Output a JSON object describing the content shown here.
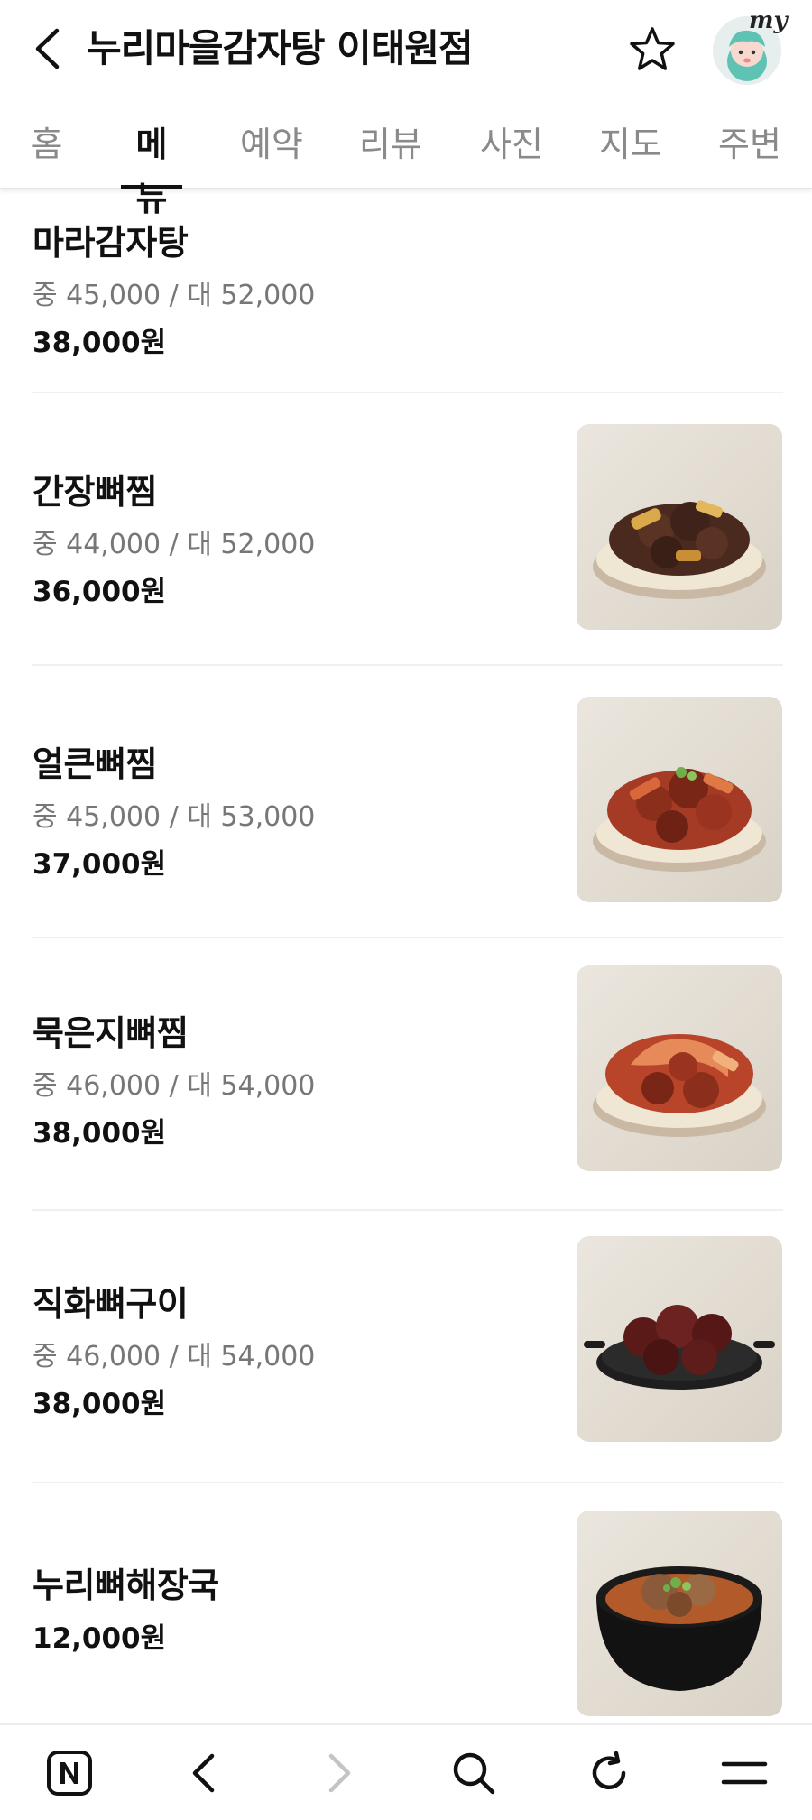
{
  "header": {
    "title": "누리마을감자탕 이태원점",
    "avatar_badge": "my"
  },
  "tabs": [
    {
      "label": "홈",
      "active": false
    },
    {
      "label": "메뉴",
      "active": true
    },
    {
      "label": "예약",
      "active": false
    },
    {
      "label": "리뷰",
      "active": false
    },
    {
      "label": "사진",
      "active": false
    },
    {
      "label": "지도",
      "active": false
    },
    {
      "label": "주변",
      "active": false
    }
  ],
  "menu": [
    {
      "name": "마라감자탕",
      "sizes": "중 45,000 / 대 52,000",
      "price": "38,000원",
      "image": false
    },
    {
      "name": "간장뼈찜",
      "sizes": "중 44,000 / 대 52,000",
      "price": "36,000원",
      "image": true
    },
    {
      "name": "얼큰뼈찜",
      "sizes": "중 45,000 / 대 53,000",
      "price": "37,000원",
      "image": true
    },
    {
      "name": "묵은지뼈찜",
      "sizes": "중 46,000 / 대 54,000",
      "price": "38,000원",
      "image": true
    },
    {
      "name": "직화뼈구이",
      "sizes": "중 46,000 / 대 54,000",
      "price": "38,000원",
      "image": true
    },
    {
      "name": "누리뼈해장국",
      "sizes": "",
      "price": "12,000원",
      "image": true
    }
  ],
  "bottom_bar": {
    "icons": [
      "naver-home-icon",
      "back-arrow-icon",
      "forward-arrow-icon",
      "search-icon",
      "refresh-icon",
      "menu-icon"
    ]
  },
  "colors": {
    "text_primary": "#111111",
    "text_secondary": "#777777",
    "tab_inactive": "#8a8a8a",
    "divider": "#f0f0f0"
  }
}
